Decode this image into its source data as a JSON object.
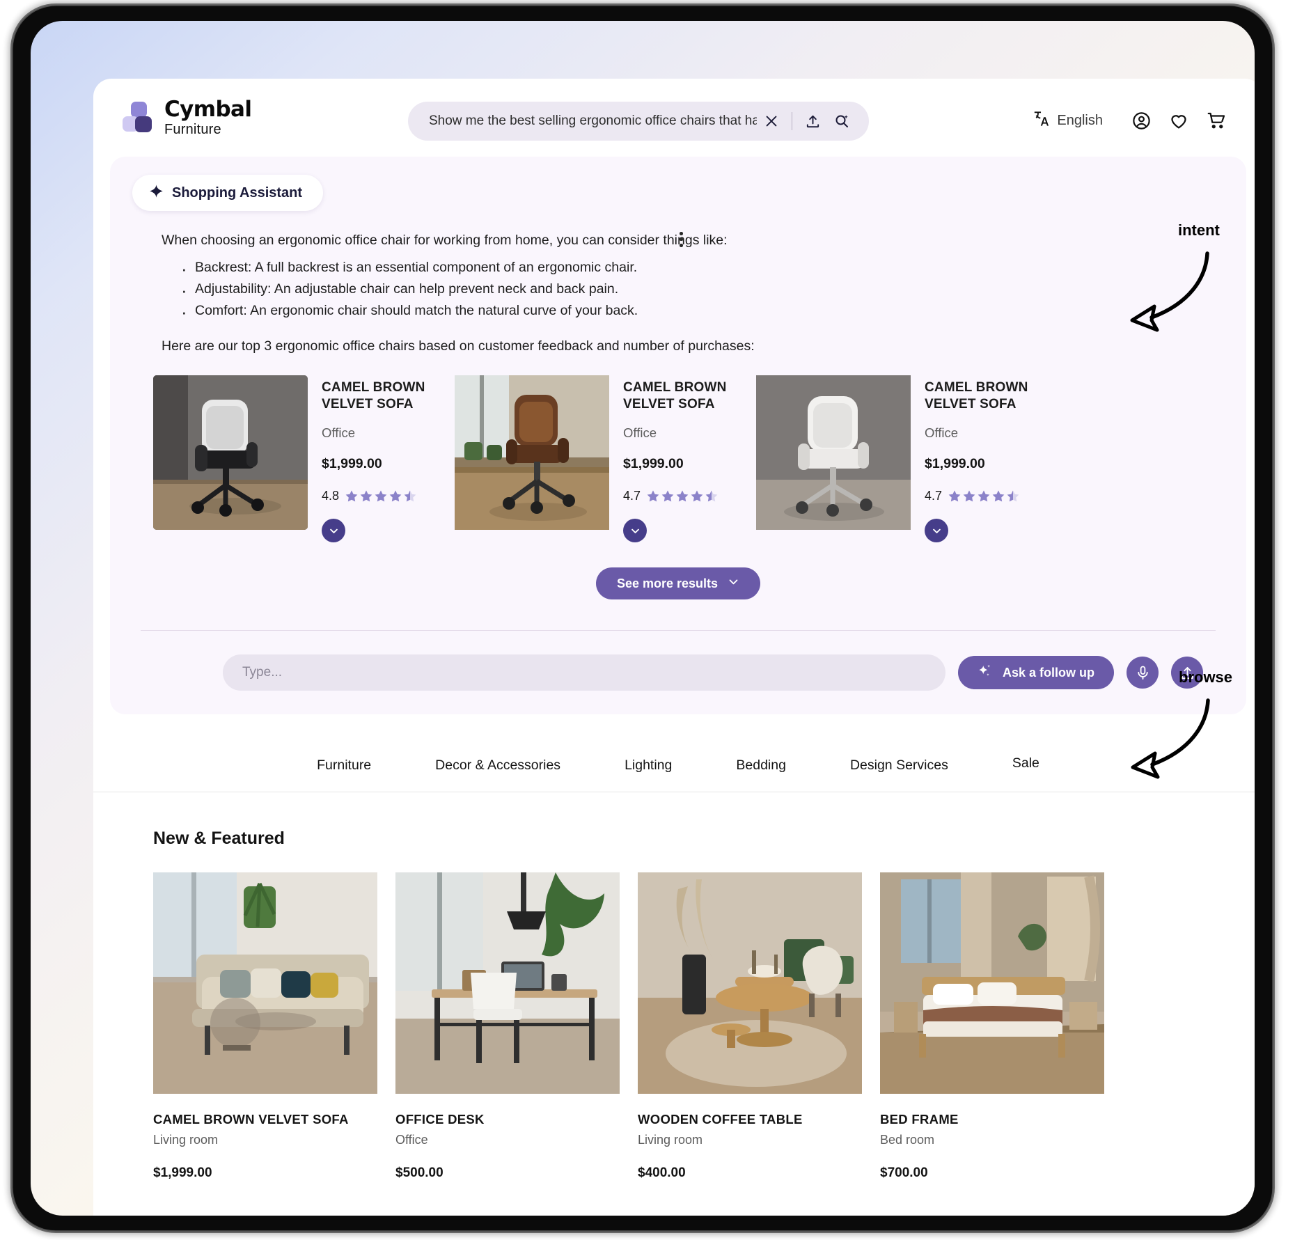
{
  "header": {
    "brand_name": "Cymbal",
    "brand_sub": "Furniture",
    "search_value": "Show me the best selling ergonomic office chairs that have...",
    "search_clear_icon": "close-icon",
    "search_upload_icon": "upload-icon",
    "search_ai_icon": "search-sparkle-icon",
    "language": "English",
    "language_icon": "translate-icon",
    "account_icon": "account-circle-icon",
    "wishlist_icon": "heart-icon",
    "cart_icon": "shopping-cart-icon"
  },
  "assistant": {
    "pill_label": "Shopping Assistant",
    "pill_icon": "sparkle-icon",
    "intro": "When choosing an ergonomic office chair for working from home, you can consider things like:",
    "bullets": [
      "Backrest: A full backrest is an essential component of an ergonomic chair.",
      "Adjustability: An adjustable chair can help prevent neck and back pain.",
      "Comfort: An ergonomic chair should match the natural curve of your back."
    ],
    "closing": "Here are our top 3 ergonomic office chairs based on customer feedback and number of purchases:",
    "menu_icon": "more-vertical-icon",
    "products": [
      {
        "title": "CAMEL BROWN VELVET SOFA",
        "category": "Office",
        "price": "$1,999.00",
        "rating": "4.8",
        "stars": 4.5,
        "expand_icon": "chevron-down-icon"
      },
      {
        "title": "CAMEL BROWN VELVET SOFA",
        "category": "Office",
        "price": "$1,999.00",
        "rating": "4.7",
        "stars": 4.5,
        "expand_icon": "chevron-down-icon"
      },
      {
        "title": "CAMEL BROWN VELVET SOFA",
        "category": "Office",
        "price": "$1,999.00",
        "rating": "4.7",
        "stars": 4.5,
        "expand_icon": "chevron-down-icon"
      }
    ],
    "see_more_label": "See more results",
    "see_more_icon": "chevron-down-icon",
    "followup_placeholder": "Type...",
    "followup_button_label": "Ask a follow up",
    "followup_button_icon": "sparkles-icon",
    "mic_icon": "microphone-icon",
    "upload_icon": "upload-icon"
  },
  "nav": {
    "items": [
      "Furniture",
      "Decor & Accessories",
      "Lighting",
      "Bedding",
      "Design Services",
      "Sale"
    ]
  },
  "featured": {
    "title": "New & Featured",
    "products": [
      {
        "name": "CAMEL BROWN VELVET SOFA",
        "category": "Living room",
        "price": "$1,999.00"
      },
      {
        "name": "OFFICE DESK",
        "category": "Office",
        "price": "$500.00"
      },
      {
        "name": "WOODEN COFFEE TABLE",
        "category": "Living room",
        "price": "$400.00"
      },
      {
        "name": "BED FRAME",
        "category": "Bed room",
        "price": "$700.00"
      }
    ]
  },
  "annotations": [
    {
      "label": "intent"
    },
    {
      "label": "browse"
    }
  ],
  "colors": {
    "accent_purple": "#6a5aa8",
    "dark_purple": "#463d8a",
    "panel_bg": "#faf6fd",
    "star_purple": "#8b82c9",
    "navy": "#1b1b3a"
  }
}
